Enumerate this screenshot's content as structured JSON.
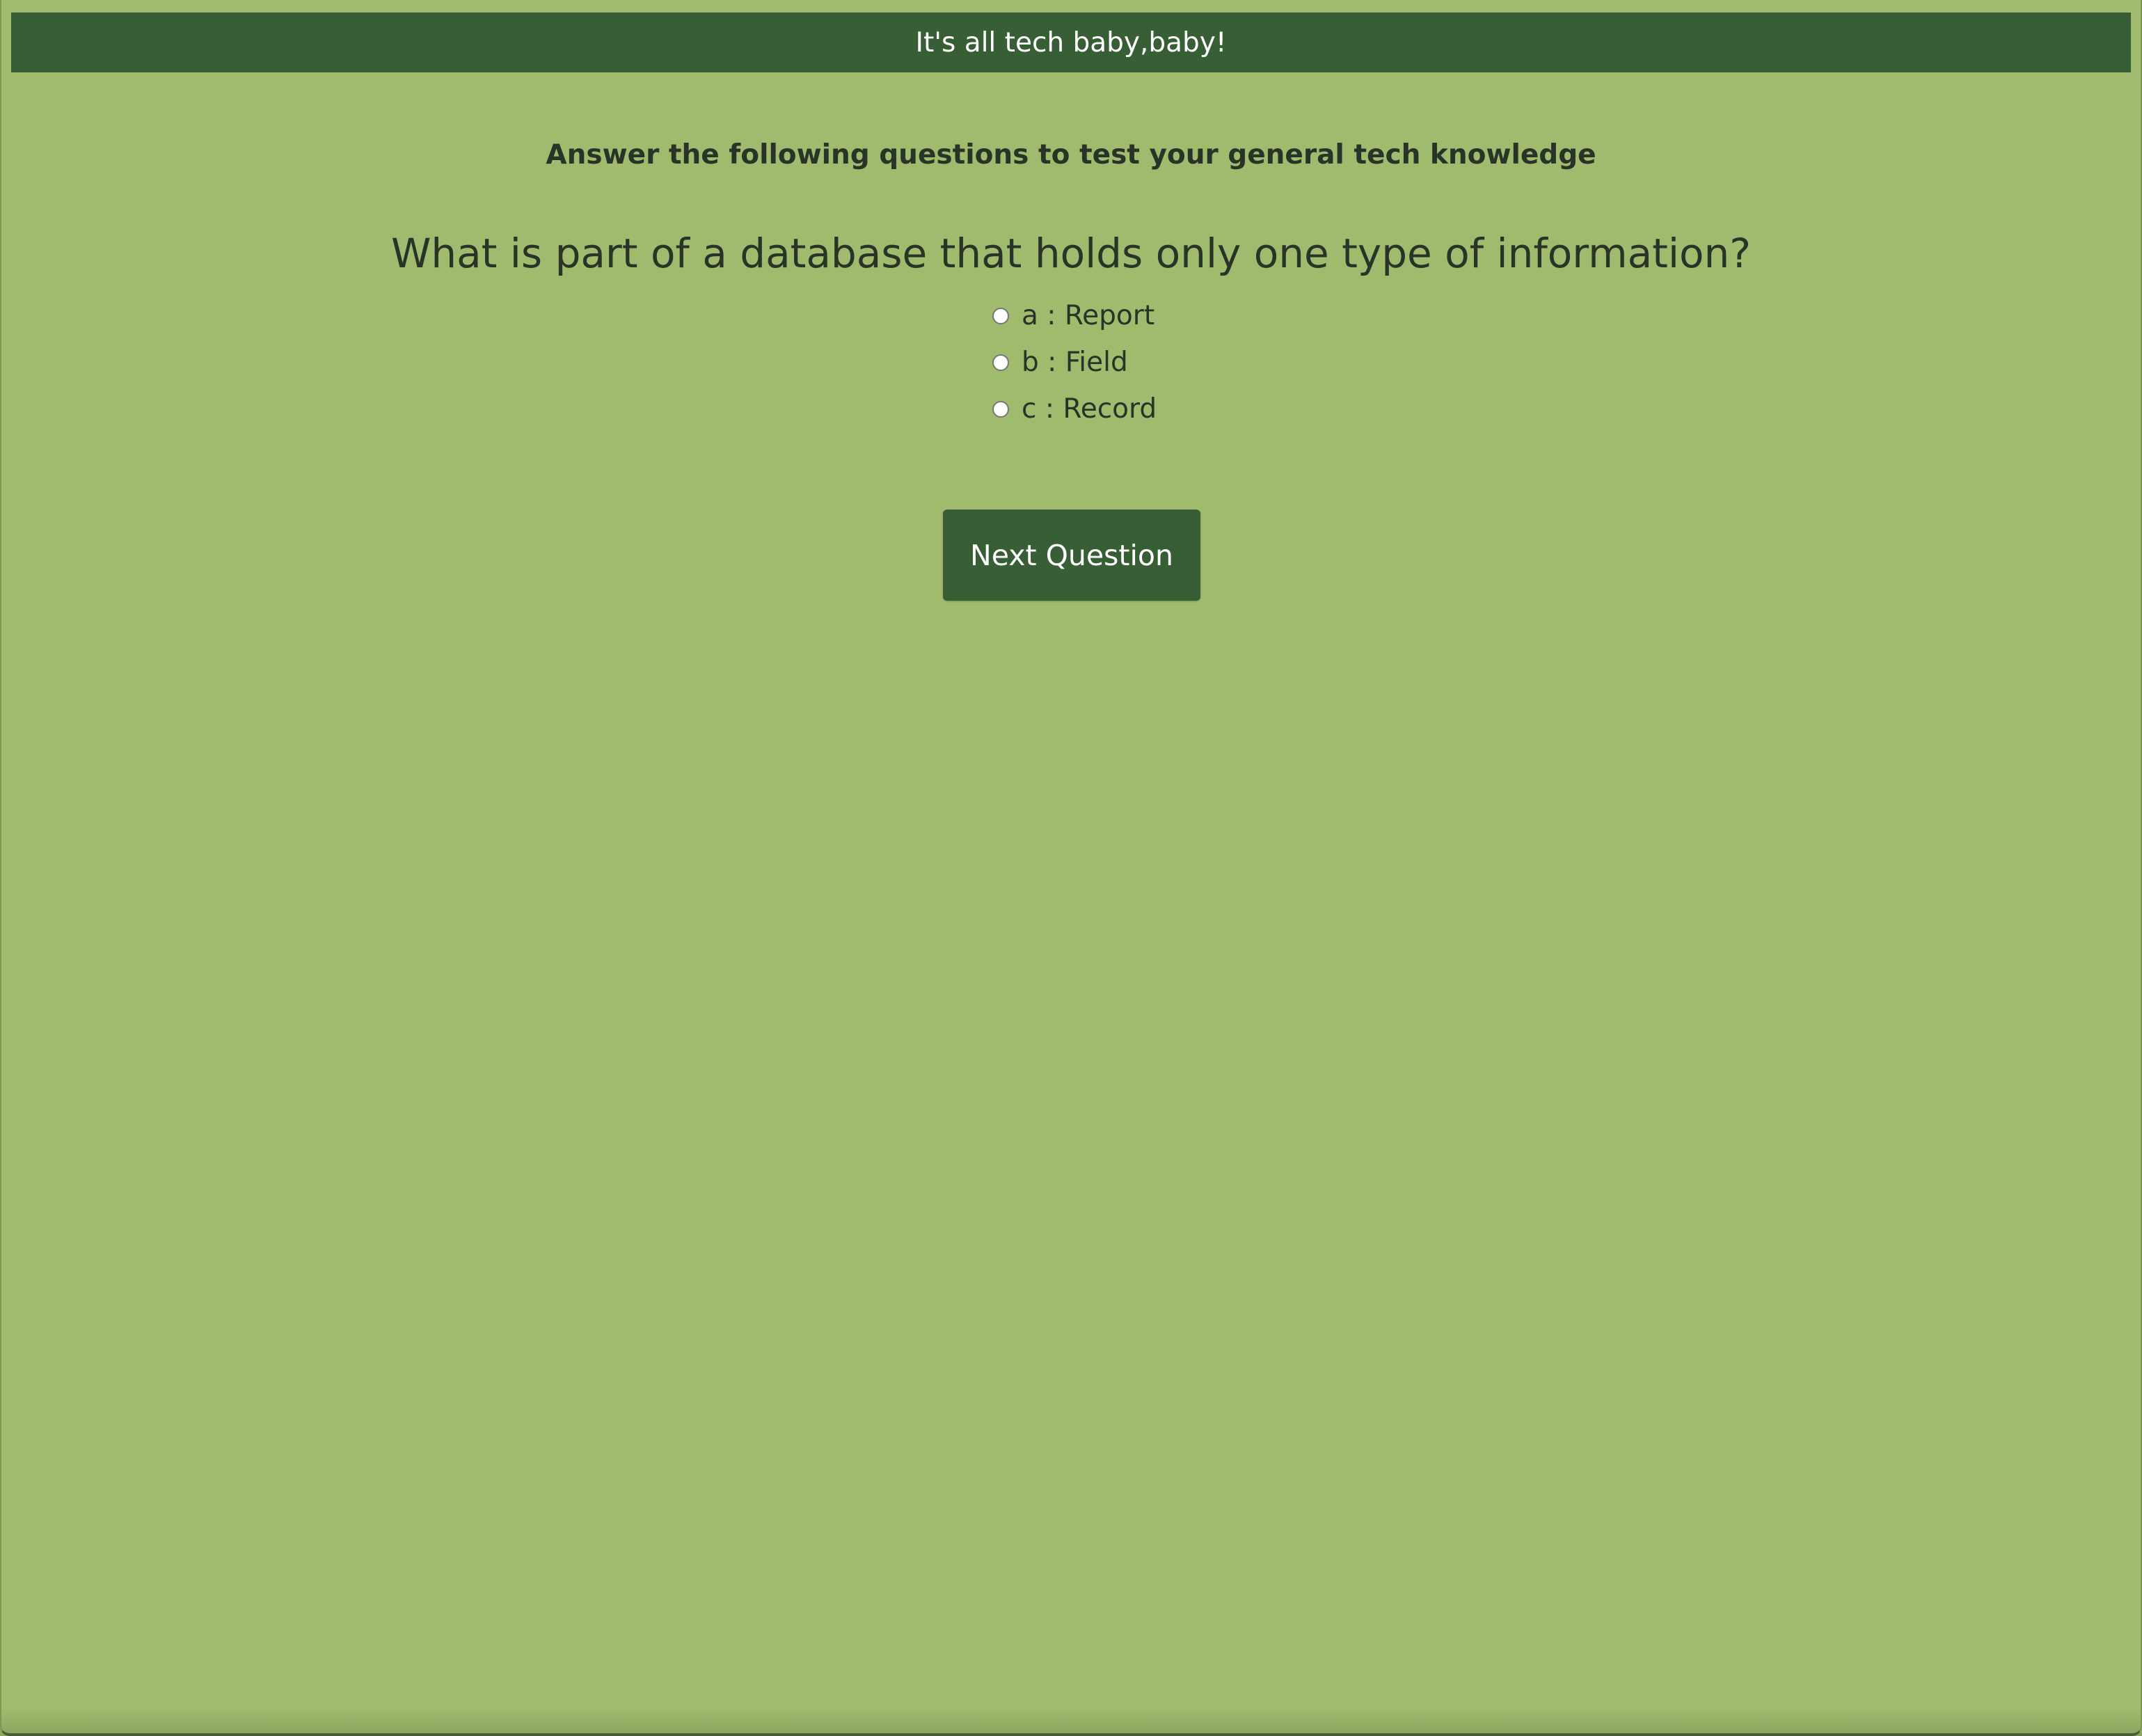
{
  "header": {
    "title": "It's all tech baby,baby!"
  },
  "quiz": {
    "instructions": "Answer the following questions to test your general tech knowledge",
    "question": "What is part of a database that holds only one type of information?",
    "options": [
      {
        "label": "a : Report"
      },
      {
        "label": "b : Field"
      },
      {
        "label": "c : Record"
      }
    ],
    "next_label": "Next Question"
  },
  "colors": {
    "background": "#a0bb6d",
    "accent": "#385e35",
    "text": "#2a3327"
  }
}
